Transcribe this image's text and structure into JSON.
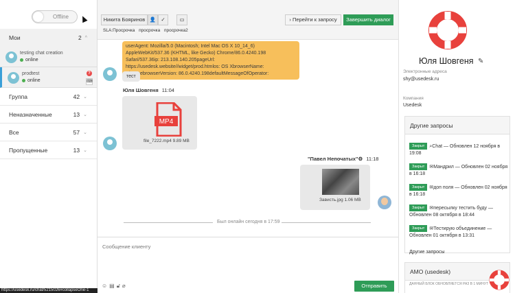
{
  "sidebar": {
    "status_label": "Offline",
    "mine": {
      "label": "Мои",
      "count": "2"
    },
    "chats": [
      {
        "title": "testing chat creation",
        "status": "online"
      },
      {
        "title": "prodtest",
        "status": "online",
        "badge": "?"
      }
    ],
    "groups": [
      {
        "label": "Группа",
        "count": "42"
      },
      {
        "label": "Неназначенные",
        "count": "13"
      },
      {
        "label": "Все",
        "count": "57"
      },
      {
        "label": "Пропущенные",
        "count": "13"
      }
    ],
    "url_tooltip": "https://usedesk.ru/chat/5215026#collapseOne-1"
  },
  "toolbar": {
    "assignee": "Никита Бояринов",
    "goto_label": "Перейти к запросу",
    "finish_label": "Завершить диалог",
    "tags": [
      "SLA:Просрочка",
      "просрочка",
      "просрочка2"
    ]
  },
  "messages": {
    "system_info": "userAgent: Mozilla/5.0 (Macintosh; Intel Mac OS X 10_14_6) AppleWebKit/537.36 (KHTML, like Gecko) Chrome/86.0.4240.198 Safari/537.36ip: 213.108.140.205pageUrl: https://usedesk.website//widget/prod.htmlos: OS XbrowserName: ChromebrowserVersion: 86.0.4240.198defaultMessageOfOperator:",
    "client_text": "тест",
    "client_sender": "Юля Шовгеня",
    "client_time": "11:04",
    "file_badge": "MP4",
    "file_name": "file_7222.mp4  9.89 MB",
    "operator_sender": "\"Павел Непочатых\"⚙",
    "operator_time": "11:18",
    "image_name": "Зависть.jpg  1.06 MB",
    "divider": "Был онлайн сегодня в 17:59"
  },
  "reply": {
    "placeholder": "Сообщение клиенту",
    "send_label": "Отправить"
  },
  "client": {
    "name": "Юля Шовгеня",
    "email_label": "Электронные адреса",
    "email": "shy@usedesk.ru",
    "company_label": "Компания",
    "company": "Usedesk"
  },
  "other_requests": {
    "title": "Другие запросы",
    "items": [
      {
        "tag": "Закрыт",
        "text": "Chat — Обновлен 12 ноября в 19:08"
      },
      {
        "tag": "Закрыт",
        "text": "Мандрил — Обновлен 02 ноября в 16:18"
      },
      {
        "tag": "Закрыт",
        "text": "доп поля — Обновлен 02 ноября в 16:18"
      },
      {
        "tag": "Закрыт",
        "text": "пересылку тестить буду — Обновлен 08 октября в 18:44"
      },
      {
        "tag": "Закрыт",
        "text": "Тестирую объединение — Обновлен 01 октября в 13:31"
      }
    ],
    "more_label": "Другие запросы"
  },
  "amo": {
    "title": "AMO (usedesk)",
    "note": "ДАННЫЙ БЛОК ОБНОВЛЯЕТСЯ РАЗ В 1 МИНУТ"
  },
  "colors": {
    "accent_green": "#2e9c57",
    "note_yellow": "#f7bf5b",
    "brand_red": "#e8413c"
  }
}
